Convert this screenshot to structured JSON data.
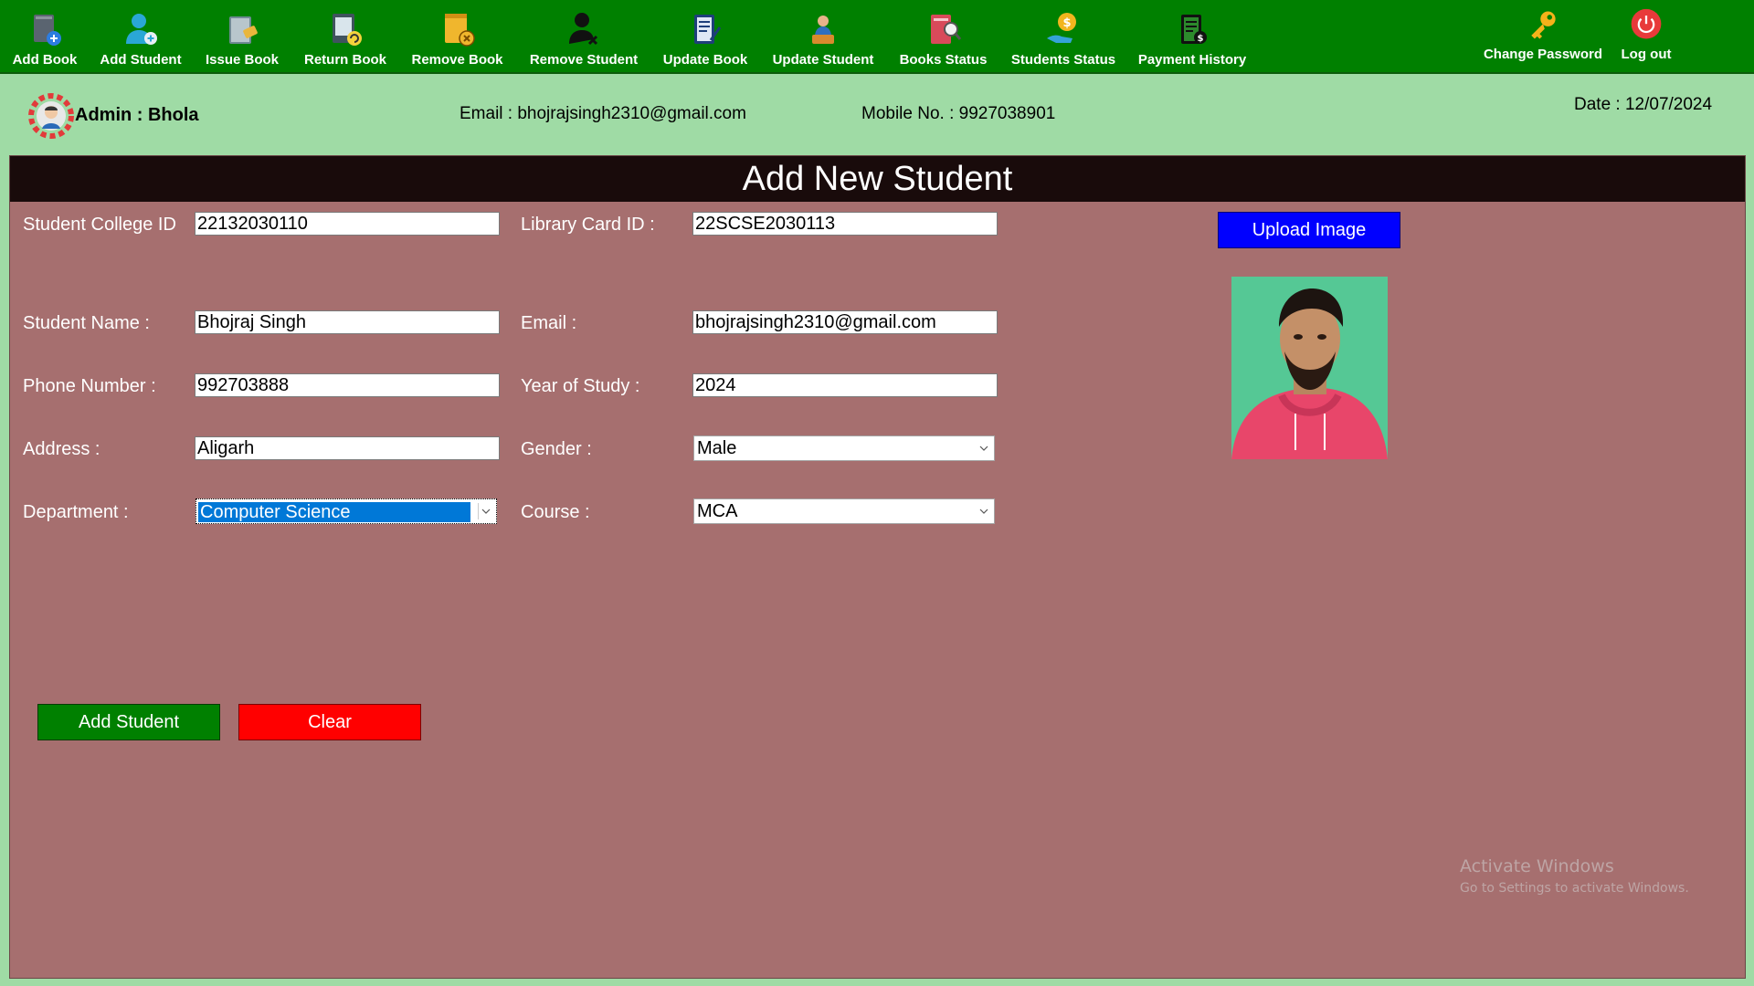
{
  "toolbar": {
    "items": [
      {
        "label": "Add Book",
        "icon": "add-book-icon"
      },
      {
        "label": "Add Student",
        "icon": "add-student-icon"
      },
      {
        "label": "Issue Book",
        "icon": "issue-book-icon"
      },
      {
        "label": "Return Book",
        "icon": "return-book-icon"
      },
      {
        "label": "Remove Book",
        "icon": "remove-book-icon"
      },
      {
        "label": "Remove Student",
        "icon": "remove-student-icon"
      },
      {
        "label": "Update Book",
        "icon": "update-book-icon"
      },
      {
        "label": "Update Student",
        "icon": "update-student-icon"
      },
      {
        "label": "Books Status",
        "icon": "books-status-icon"
      },
      {
        "label": "Students Status",
        "icon": "students-status-icon"
      },
      {
        "label": "Payment History",
        "icon": "payment-history-icon"
      }
    ],
    "change_password": {
      "label": "Change Password",
      "icon": "key-icon"
    },
    "logout": {
      "label": "Log out",
      "icon": "power-icon"
    }
  },
  "header": {
    "admin_label": "Admin : Bhola",
    "email": "Email : bhojrajsingh2310@gmail.com",
    "mobile": "Mobile No. : 9927038901",
    "date": "Date : 12/07/2024"
  },
  "form": {
    "title": "Add New Student",
    "fields": {
      "college_id": {
        "label": "Student College ID",
        "value": "22132030110"
      },
      "library_card": {
        "label": "Library Card ID :",
        "value": "22SCSE2030113"
      },
      "name": {
        "label": "Student Name :",
        "value": "Bhojraj Singh"
      },
      "email": {
        "label": "Email :",
        "value": "bhojrajsingh2310@gmail.com"
      },
      "phone": {
        "label": "Phone Number :",
        "value": "992703888"
      },
      "year": {
        "label": "Year of Study :",
        "value": "2024"
      },
      "address": {
        "label": "Address :",
        "value": "Aligarh"
      },
      "gender": {
        "label": "Gender :",
        "value": "Male"
      },
      "department": {
        "label": "Department :",
        "value": "Computer Science"
      },
      "course": {
        "label": "Course :",
        "value": "MCA"
      }
    },
    "upload_label": "Upload Image",
    "add_label": "Add Student",
    "clear_label": "Clear"
  },
  "watermark": {
    "line1": "Activate Windows",
    "line2": "Go to Settings to activate Windows."
  },
  "colors": {
    "toolbar_bg": "#008000",
    "page_bg": "#9fdba5",
    "panel_bg": "#a66f6f",
    "title_bar_bg": "#190b0b",
    "upload_btn": "#0000ff",
    "add_btn": "#008000",
    "clear_btn": "#ff0000",
    "selection": "#0078d7"
  }
}
